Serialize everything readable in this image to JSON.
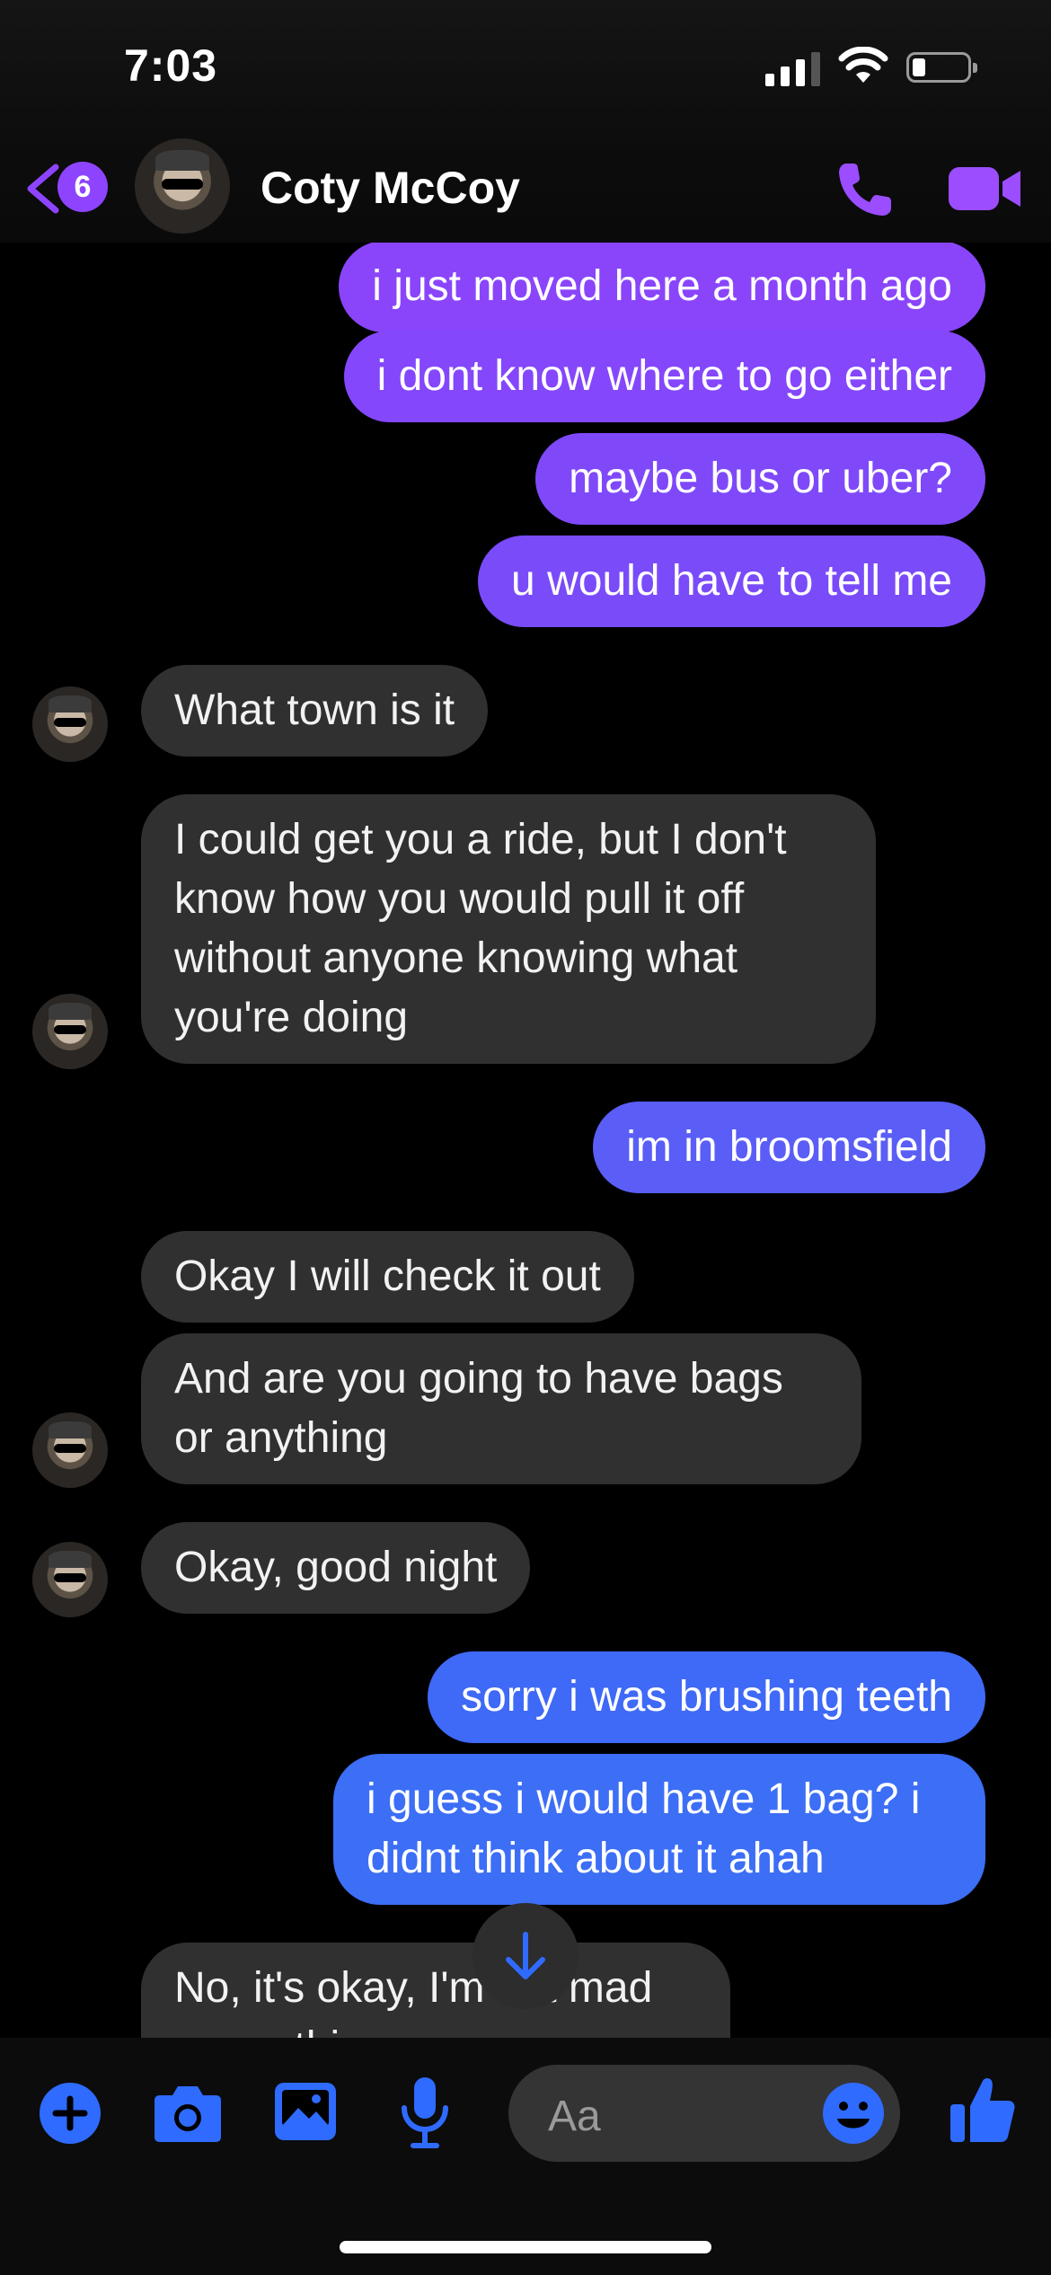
{
  "status_bar": {
    "time": "7:03"
  },
  "header": {
    "back_badge": "6",
    "contact_name": "Coty McCoy",
    "icons": [
      "chevron-left-icon",
      "phone-icon",
      "video-camera-icon"
    ]
  },
  "messages": [
    {
      "from": "me",
      "text": "i just moved here a month ago"
    },
    {
      "from": "me",
      "text": "i dont know where to go either"
    },
    {
      "from": "me",
      "text": "maybe bus or uber?"
    },
    {
      "from": "me",
      "text": "u would have to tell me"
    },
    {
      "from": "them",
      "text": "What town is it"
    },
    {
      "from": "them",
      "text": "I could get you a ride, but I don't know how you would pull it off without anyone knowing what you're doing"
    },
    {
      "from": "me",
      "text": "im in broomsfield"
    },
    {
      "from": "them",
      "text": "Okay I will check it out"
    },
    {
      "from": "them",
      "text": "And are you going to have bags or anything"
    },
    {
      "from": "them",
      "text": "Okay, good night"
    },
    {
      "from": "me",
      "text": "sorry i was brushing teeth"
    },
    {
      "from": "me",
      "text": "i guess i would have 1 bag? i didnt think about it ahah"
    },
    {
      "from": "them",
      "text": "No, it's okay, I'm not mad or anything"
    }
  ],
  "composer": {
    "placeholder": "Aa",
    "icons": [
      "plus-icon",
      "camera-icon",
      "photo-icon",
      "microphone-icon",
      "emoji-icon",
      "thumbs-up-icon"
    ]
  },
  "colors": {
    "outgoing_top": "#8e44ff",
    "outgoing_bottom": "#3c6ef6",
    "incoming": "#303030",
    "accent": "#2f6bff"
  }
}
